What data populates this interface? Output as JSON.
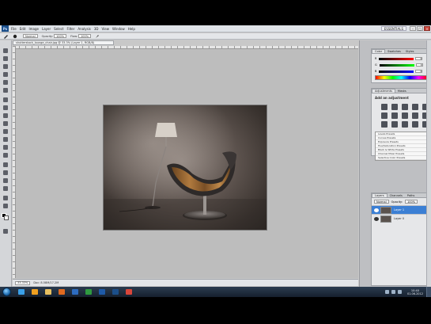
{
  "menubar": {
    "app_logo": "Ps",
    "items": [
      "File",
      "Edit",
      "Image",
      "Layer",
      "Select",
      "Filter",
      "Analysis",
      "3D",
      "View",
      "Window",
      "Help"
    ],
    "workspace": "ESSENTIALS",
    "window_buttons": [
      "–",
      "□",
      "×"
    ]
  },
  "options_bar": {
    "mode_label": "Normal",
    "opacity_label": "Opacity:",
    "opacity_value": "100%",
    "flow_label": "Flow:",
    "flow_value": "100%"
  },
  "document": {
    "tab_title": "shutterstock_lounge_chair.jpg @ 33.3% (Layer 1, RGB/8)"
  },
  "status_bar": {
    "zoom": "33.33%",
    "doc_info": "Doc: 8.58M/17.2M"
  },
  "color_panel": {
    "tabs": [
      "Color",
      "Swatches",
      "Styles"
    ],
    "channels": [
      {
        "label": "R",
        "value": "0",
        "gradient": "linear-gradient(90deg,#000,#f00)"
      },
      {
        "label": "G",
        "value": "0",
        "gradient": "linear-gradient(90deg,#000,#0f0)"
      },
      {
        "label": "B",
        "value": "0",
        "gradient": "linear-gradient(90deg,#000,#00f)"
      }
    ]
  },
  "adjustments_panel": {
    "tabs": [
      "Adjustments",
      "Masks"
    ],
    "title": "Add an adjustment",
    "presets": [
      "Levels Presets",
      "Curves Presets",
      "Exposure Presets",
      "Hue/Saturation Presets",
      "Black & White Presets",
      "Channel Mixer Presets",
      "Selective Color Presets"
    ]
  },
  "layers_panel": {
    "tabs": [
      "Layers",
      "Channels",
      "Paths"
    ],
    "blend_mode": "Normal",
    "opacity_label": "Opacity:",
    "opacity_value": "100%",
    "layers": [
      {
        "name": "Layer 1",
        "selected": true
      },
      {
        "name": "Layer 0",
        "selected": false
      }
    ]
  },
  "taskbar": {
    "apps": [
      {
        "name": "ie-icon",
        "color": "#3aa0e8"
      },
      {
        "name": "media-player-icon",
        "color": "#f0a020"
      },
      {
        "name": "explorer-icon",
        "color": "#e8c060"
      },
      {
        "name": "firefox-icon",
        "color": "#e06a20"
      },
      {
        "name": "word-icon",
        "color": "#2d6cc0"
      },
      {
        "name": "excel-icon",
        "color": "#2f9a40"
      },
      {
        "name": "outlook-icon",
        "color": "#1e5aa8"
      },
      {
        "name": "photoshop-icon",
        "color": "#1b4f8a"
      },
      {
        "name": "chrome-icon",
        "color": "#d9463a"
      }
    ],
    "time": "10:40",
    "date": "01.06.2012"
  }
}
